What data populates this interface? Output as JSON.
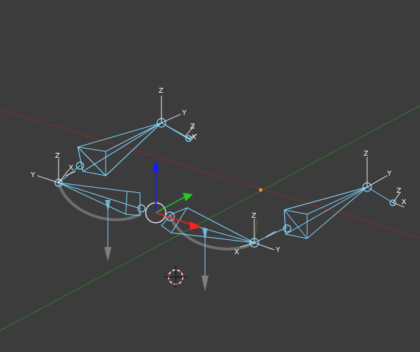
{
  "viewport": {
    "background": "#3c3c3c",
    "grid_x_axis_color": "#8a2b2b",
    "grid_y_axis_color": "#2f7a2f",
    "bone_color": "#7fd4ff",
    "manipulator": {
      "x_color": "#ff2020",
      "y_color": "#22cc22",
      "z_color": "#1a1aff"
    },
    "gizmos": [
      {
        "id": "top-left",
        "x_label": "X",
        "y_label": "Y",
        "z_label": "Z"
      },
      {
        "id": "left",
        "x_label": "X",
        "y_label": "Y",
        "z_label": "Z"
      },
      {
        "id": "center",
        "x_label": "X",
        "y_label": "Y",
        "z_label": "Z"
      },
      {
        "id": "right",
        "x_label": "X",
        "y_label": "Y",
        "z_label": "Z"
      }
    ],
    "icons": [
      "3d-cursor-icon",
      "object-origin-icon",
      "transform-manipulator-icon"
    ]
  }
}
